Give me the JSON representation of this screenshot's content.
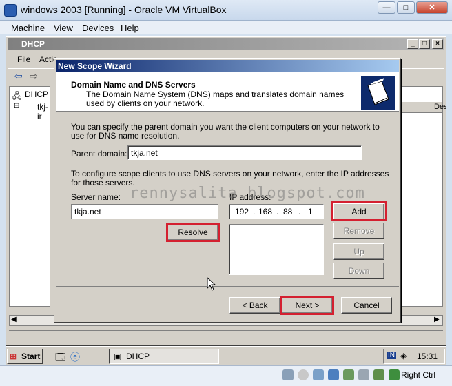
{
  "vbox": {
    "title": "windows 2003 [Running] - Oracle VM VirtualBox",
    "menu": [
      "Machine",
      "View",
      "Devices",
      "Help"
    ],
    "status_right": "Right Ctrl"
  },
  "dhcp": {
    "title": "DHCP",
    "menu": [
      "File",
      "Actio"
    ],
    "tree": {
      "root": "DHCP",
      "server": "tkj-ir"
    },
    "right_header": "Des"
  },
  "taskbar": {
    "start": "Start",
    "task": "DHCP",
    "tray_lang": "IN",
    "clock": "15:31"
  },
  "wizard": {
    "title": "New Scope Wizard",
    "heading": "Domain Name and DNS Servers",
    "subheading": "The Domain Name System (DNS) maps and translates domain names used by clients on your network.",
    "intro": "You can specify the parent domain you want the client computers on your network to use for DNS name resolution.",
    "parent_domain_label": "Parent domain:",
    "parent_domain_value": "tkja.net",
    "dns_intro": "To configure scope clients to use DNS servers on your network, enter the IP addresses for those servers.",
    "server_name_label": "Server name:",
    "server_name_value": "tkja.net",
    "ip_label": "IP address:",
    "ip_octets": [
      "192",
      "168",
      "88",
      "1"
    ],
    "buttons": {
      "resolve": "Resolve",
      "add": "Add",
      "remove": "Remove",
      "up": "Up",
      "down": "Down",
      "back": "< Back",
      "next": "Next >",
      "cancel": "Cancel"
    }
  },
  "watermark": "rennysalita.blogspot.com",
  "colors": {
    "highlight": "#d42030",
    "wizard_title": "#0a246a"
  }
}
